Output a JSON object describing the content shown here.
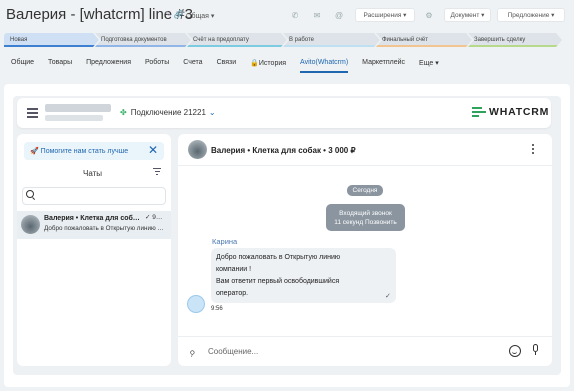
{
  "header": {
    "title": "Валерия - [whatcrm] line #3",
    "badge": "Общая",
    "buttons": {
      "extensions": "Расширения",
      "document": "Документ",
      "proposal": "Предложение"
    }
  },
  "stages": [
    {
      "label": "Новая",
      "bg": "#cfe0f5",
      "bar": "#3d7fd1"
    },
    {
      "label": "Подготовка документов",
      "bg": "#dde3e8",
      "bar": "#8fb6e6"
    },
    {
      "label": "Счёт на предоплату",
      "bg": "#dde3e8",
      "bar": "#7dcbe0"
    },
    {
      "label": "В работе",
      "bg": "#dde3e8",
      "bar": "#bfe0f0"
    },
    {
      "label": "Финальный счёт",
      "bg": "#dde3e8",
      "bar": "#f2c48f"
    },
    {
      "label": "Завершить сделку",
      "bg": "#dde3e8",
      "bar": "#b7d98c"
    }
  ],
  "tabs": [
    "Общие",
    "Товары",
    "Предложения",
    "Роботы",
    "Счета",
    "Связи",
    "История",
    "Avito(Whatcrm)",
    "Маркетплейс",
    "Еще"
  ],
  "topbar": {
    "connection": "Подключение 21221",
    "logo": "WHATCRM"
  },
  "left": {
    "help": "Помогите нам стать лучше",
    "chats_title": "Чаты",
    "search_placeholder": "",
    "chat": {
      "name": "Валерия • Клетка для соб…",
      "snippet": "Добро пожаловать в Открытую линию …",
      "meta": "9…"
    }
  },
  "conversation": {
    "title": "Валерия • Клетка для собак • 3 000 ₽",
    "date": "Сегодня",
    "system_line1": "Входящий звонок",
    "system_line2": "11 секунд Позвонить",
    "sender": "Карина",
    "message_line1": "Добро пожаловать в Открытую линию",
    "message_line2": "компании !",
    "message_line3": "Вам ответит первый освободившийся",
    "message_line4": "оператор.",
    "time": "9:56",
    "composer_placeholder": "Сообщение..."
  }
}
